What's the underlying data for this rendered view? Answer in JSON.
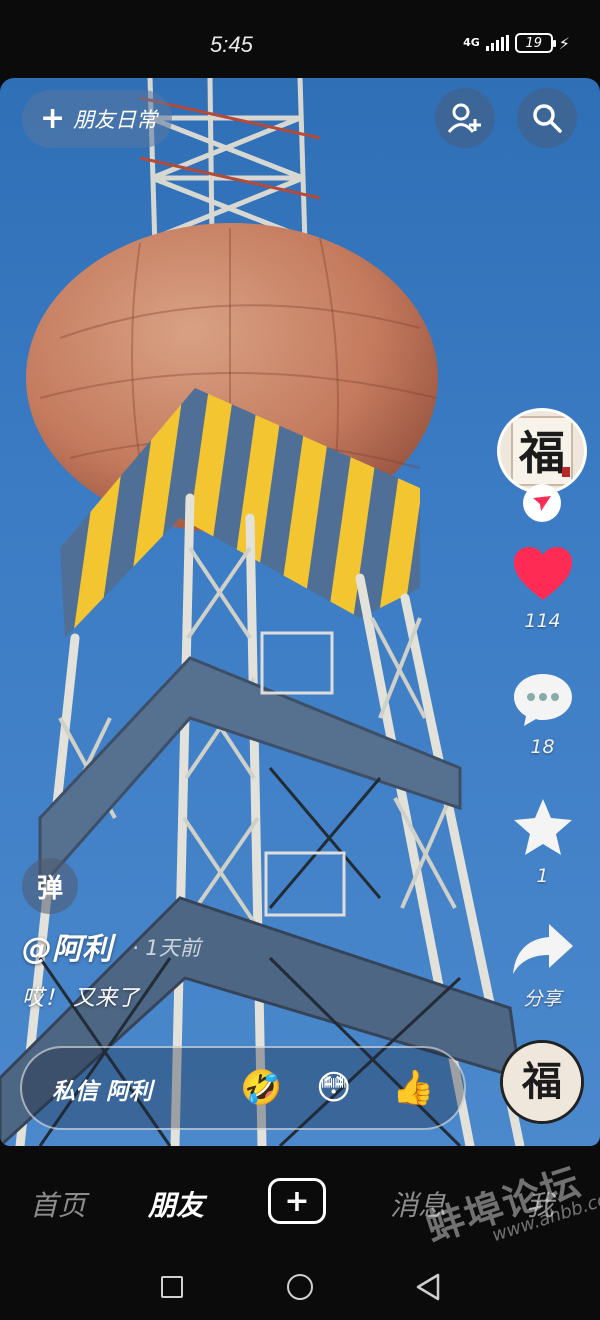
{
  "status_bar": {
    "time": "5:45",
    "network": "4G",
    "battery": "19"
  },
  "top": {
    "friends_daily_label": "朋友日常",
    "add_friend_icon": "add-friend-icon",
    "search_icon": "search-icon"
  },
  "rail": {
    "avatar_glyph": "福",
    "likes": "114",
    "comments": "18",
    "favorites": "1",
    "share_label": "分享",
    "like_color": "#fe2c55"
  },
  "post": {
    "danmu_label": "弹",
    "author": "@阿利",
    "time_ago": "· 1天前",
    "caption": "哎！ 又来了"
  },
  "dm_bar": {
    "label": "私信 阿利",
    "quick_emojis": [
      "🤣",
      "😳",
      "👍"
    ]
  },
  "bottom_nav": {
    "items": [
      "首页",
      "朋友",
      "消息",
      "我"
    ],
    "active": "朋友"
  },
  "watermark": {
    "main": "蚌埠论坛",
    "url": "www.ahbb.cc"
  }
}
